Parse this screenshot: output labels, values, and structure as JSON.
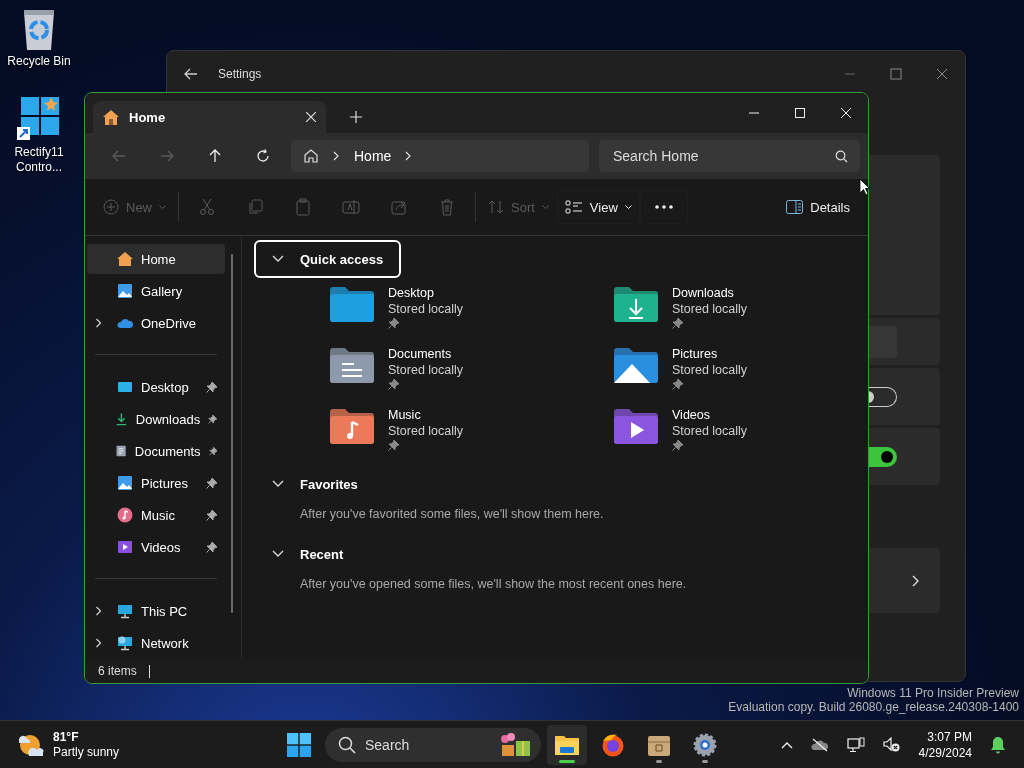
{
  "desktop_icons": [
    {
      "label": "Recycle Bin"
    },
    {
      "label": "Rectify11 Contro..."
    }
  ],
  "settings_window": {
    "title": "Settings",
    "toggles": [
      {
        "on": false
      },
      {
        "on": true
      }
    ]
  },
  "explorer": {
    "tabs": [
      {
        "label": "Home",
        "selected": true
      }
    ],
    "nav_buttons": [
      {
        "kind": "back",
        "disabled": true
      },
      {
        "kind": "forward",
        "disabled": true
      },
      {
        "kind": "up",
        "disabled": false
      },
      {
        "kind": "refresh",
        "disabled": false
      }
    ],
    "breadcrumb": [
      "Home"
    ],
    "search": {
      "placeholder": "Search Home"
    },
    "toolbar": [
      {
        "kind": "new",
        "label": "New",
        "disabled": true,
        "dropdown": true
      },
      {
        "kind": "cut",
        "disabled": true,
        "dropdown": false
      },
      {
        "kind": "copy",
        "disabled": true,
        "dropdown": false
      },
      {
        "kind": "paste",
        "disabled": true,
        "dropdown": false
      },
      {
        "kind": "rename",
        "disabled": true,
        "dropdown": false
      },
      {
        "kind": "share",
        "disabled": true,
        "dropdown": false
      },
      {
        "kind": "delete",
        "disabled": true,
        "dropdown": false
      },
      {
        "kind": "sort",
        "label": "Sort",
        "disabled": true,
        "dropdown": true
      },
      {
        "kind": "view",
        "label": "View",
        "disabled": false,
        "dropdown": true
      },
      {
        "kind": "more",
        "disabled": false,
        "dropdown": false
      }
    ],
    "details_button": {
      "label": "Details"
    },
    "sidebar": {
      "groups": [
        [
          {
            "label": "Home",
            "kind": "plain",
            "selected": true
          },
          {
            "label": "Gallery",
            "kind": "plain",
            "selected": false
          },
          {
            "label": "OneDrive",
            "kind": "expandable",
            "expanded": false,
            "selected": false
          }
        ],
        [
          {
            "label": "Desktop",
            "kind": "pinned",
            "selected": false
          },
          {
            "label": "Downloads",
            "kind": "pinned",
            "selected": false
          },
          {
            "label": "Documents",
            "kind": "pinned",
            "selected": false
          },
          {
            "label": "Pictures",
            "kind": "pinned",
            "selected": false
          },
          {
            "label": "Music",
            "kind": "pinned",
            "selected": false
          },
          {
            "label": "Videos",
            "kind": "pinned",
            "selected": false
          }
        ],
        [
          {
            "label": "This PC",
            "kind": "expandable",
            "expanded": false,
            "selected": false
          },
          {
            "label": "Network",
            "kind": "expandable",
            "expanded": false,
            "selected": false
          }
        ]
      ]
    },
    "sections": [
      {
        "title": "Quick access",
        "expanded": true,
        "focused": true,
        "items": [
          {
            "name": "Desktop",
            "status": "Stored locally",
            "pinned": true
          },
          {
            "name": "Downloads",
            "status": "Stored locally",
            "pinned": true
          },
          {
            "name": "Documents",
            "status": "Stored locally",
            "pinned": true
          },
          {
            "name": "Pictures",
            "status": "Stored locally",
            "pinned": true
          },
          {
            "name": "Music",
            "status": "Stored locally",
            "pinned": true
          },
          {
            "name": "Videos",
            "status": "Stored locally",
            "pinned": true
          }
        ]
      },
      {
        "title": "Favorites",
        "expanded": true,
        "focused": false,
        "message": "After you've favorited some files, we'll show them here."
      },
      {
        "title": "Recent",
        "expanded": true,
        "focused": false,
        "message": "After you've opened some files, we'll show the most recent ones here."
      }
    ],
    "status_bar": {
      "item_count": "6 items"
    }
  },
  "build_info": [
    "Windows 11 Pro Insider Preview",
    "Evaluation copy. Build 26080.ge_release.240308-1400"
  ],
  "taskbar": {
    "weather": {
      "temperature": "81°F",
      "condition": "Partly sunny"
    },
    "search": {
      "placeholder": "Search"
    },
    "apps": [
      {
        "active": true,
        "running": true
      },
      {
        "active": false,
        "running": false
      },
      {
        "active": false,
        "running": true
      },
      {
        "active": false,
        "running": true
      }
    ],
    "clock": {
      "time": "3:07 PM",
      "date": "4/29/2024"
    }
  }
}
